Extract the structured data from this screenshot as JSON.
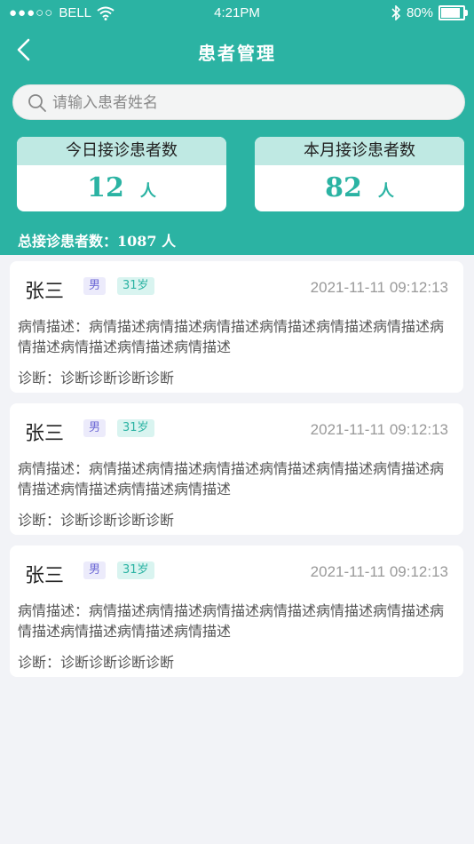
{
  "status_bar": {
    "carrier": "BELL",
    "signal_dots": "●●●○○",
    "time": "4:21PM",
    "battery": "80%"
  },
  "nav": {
    "title": "患者管理"
  },
  "search": {
    "placeholder": "请输入患者姓名"
  },
  "stats": {
    "today_label": "今日接诊患者数",
    "today_value": "12",
    "month_label": "本月接诊患者数",
    "month_value": "82",
    "unit": "人",
    "total_text": "总接诊患者数：1087 人"
  },
  "patients": [
    {
      "name": "张三",
      "gender": "男",
      "age": "31岁",
      "time": "2021-11-11   09:12:13",
      "description": "病情描述：病情描述病情描述病情描述病情描述病情描述病情描述病情描述病情描述病情描述病情描述",
      "diagnosis": "诊断：诊断诊断诊断诊断"
    },
    {
      "name": "张三",
      "gender": "男",
      "age": "31岁",
      "time": "2021-11-11   09:12:13",
      "description": "病情描述：病情描述病情描述病情描述病情描述病情描述病情描述病情描述病情描述病情描述病情描述",
      "diagnosis": "诊断：诊断诊断诊断诊断"
    },
    {
      "name": "张三",
      "gender": "男",
      "age": "31岁",
      "time": "2021-11-11   09:12:13",
      "description": "病情描述：病情描述病情描述病情描述病情描述病情描述病情描述病情描述病情描述病情描述病情描述",
      "diagnosis": "诊断：诊断诊断诊断诊断"
    }
  ],
  "colors": {
    "primary": "#2bb3a3",
    "stat_head": "#bfe9e3",
    "background": "#f2f3f7"
  }
}
